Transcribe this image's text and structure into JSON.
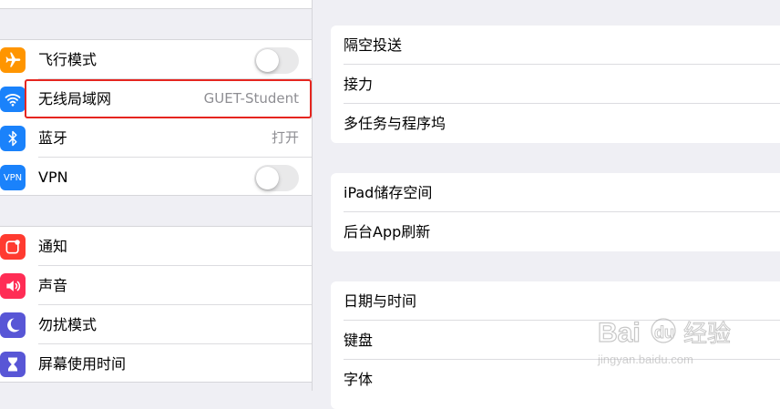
{
  "sidebar": {
    "group1": [
      {
        "label": "飞行模式",
        "icon": "airplane-icon",
        "icon_color": "#ff9500",
        "control": "toggle",
        "toggle_on": false
      },
      {
        "label": "无线局域网",
        "icon": "wifi-icon",
        "icon_color": "#1a82fb",
        "control": "value",
        "value": "GUET-Student"
      },
      {
        "label": "蓝牙",
        "icon": "bluetooth-icon",
        "icon_color": "#1a82fb",
        "control": "value",
        "value": "打开"
      },
      {
        "label": "VPN",
        "icon": "vpn-icon",
        "icon_text": "VPN",
        "icon_color": "#1a82fb",
        "control": "toggle",
        "toggle_on": false
      }
    ],
    "group2": [
      {
        "label": "通知",
        "icon": "notifications-icon",
        "icon_color": "#ff3b30"
      },
      {
        "label": "声音",
        "icon": "sound-icon",
        "icon_color": "#ff2d55"
      },
      {
        "label": "勿扰模式",
        "icon": "moon-icon",
        "icon_color": "#5856d6"
      },
      {
        "label": "屏幕使用时间",
        "icon": "hourglass-icon",
        "icon_color": "#5856d6"
      }
    ]
  },
  "panel": {
    "card1": [
      "隔空投送",
      "接力",
      "多任务与程序坞"
    ],
    "card2": [
      "iPad储存空间",
      "后台App刷新"
    ],
    "card3": [
      "日期与时间",
      "键盘",
      "字体"
    ]
  },
  "watermark": {
    "brand": "Baidu",
    "cn": "经验",
    "url": "jingyan.baidu.com"
  },
  "colors": {
    "background": "#efeff4",
    "highlight_border": "#e5251f"
  }
}
